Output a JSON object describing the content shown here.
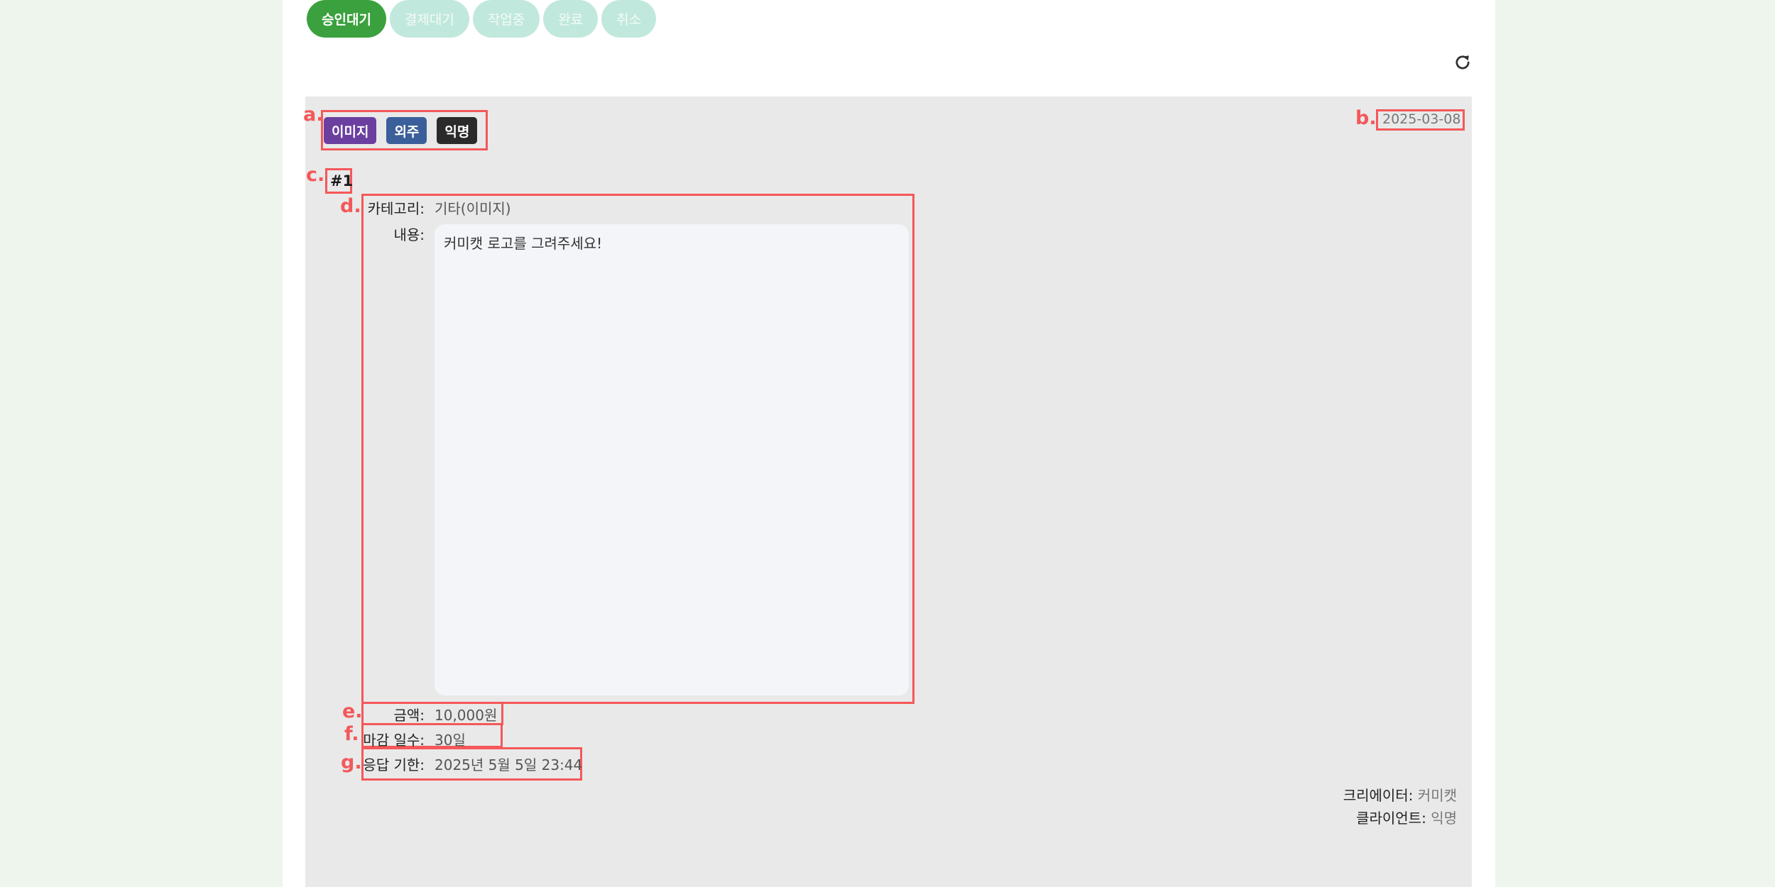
{
  "tabs": [
    {
      "label": "승인대기",
      "active": true
    },
    {
      "label": "결제대기",
      "active": false
    },
    {
      "label": "작업중",
      "active": false
    },
    {
      "label": "완료",
      "active": false
    },
    {
      "label": "취소",
      "active": false
    }
  ],
  "markers": {
    "a": "a.",
    "b": "b.",
    "c": "c.",
    "d": "d.",
    "e": "e.",
    "f": "f.",
    "g": "g."
  },
  "card": {
    "tags": [
      {
        "label": "이미지",
        "color": "#6b3fa0"
      },
      {
        "label": "외주",
        "color": "#3b5f9a"
      },
      {
        "label": "익명",
        "color": "#2a2a2a"
      }
    ],
    "date": "2025-03-08",
    "number": "#1",
    "fields": {
      "category_label": "카테고리:",
      "category_value": "기타(이미지)",
      "content_label": "내용:",
      "content_value": "커미캣 로고를 그려주세요!",
      "amount_label": "금액:",
      "amount_value": "10,000원",
      "deadline_days_label": "마감 일수:",
      "deadline_days_value": "30일",
      "response_due_label": "응답 기한:",
      "response_due_value": "2025년 5월 5일 23:44"
    },
    "creator_label": "크리에이터:",
    "creator_value": "커미캣",
    "client_label": "클라이언트:",
    "client_value": "익명"
  },
  "colors": {
    "accent": "#3ba13e",
    "tab_inactive": "#c1e8dc",
    "highlight": "#f4585a"
  },
  "icons": {
    "refresh": "refresh-icon"
  }
}
